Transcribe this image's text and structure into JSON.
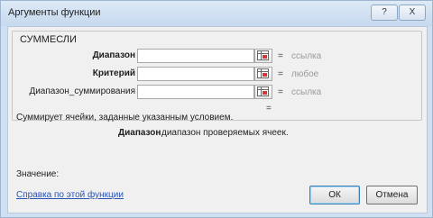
{
  "window": {
    "title": "Аргументы функции",
    "help_button": "?",
    "close_button": "X"
  },
  "function_group": {
    "name": "СУММЕСЛИ",
    "arguments": [
      {
        "label": "Диапазон",
        "value": "",
        "hint": "ссылка",
        "bold": true
      },
      {
        "label": "Критерий",
        "value": "",
        "hint": "любое",
        "bold": true
      },
      {
        "label": "Диапазон_суммирования",
        "value": "",
        "hint": "ссылка",
        "bold": false
      }
    ],
    "equals": "=",
    "result_equals": "="
  },
  "description": {
    "text": "Суммирует ячейки, заданные указанным условием.",
    "argument_name": "Диапазон",
    "argument_text": "диапазон проверяемых ячеек."
  },
  "value_label": "Значение:",
  "help_link": "Справка по этой функции",
  "buttons": {
    "ok": "ОК",
    "cancel": "Отмена"
  }
}
